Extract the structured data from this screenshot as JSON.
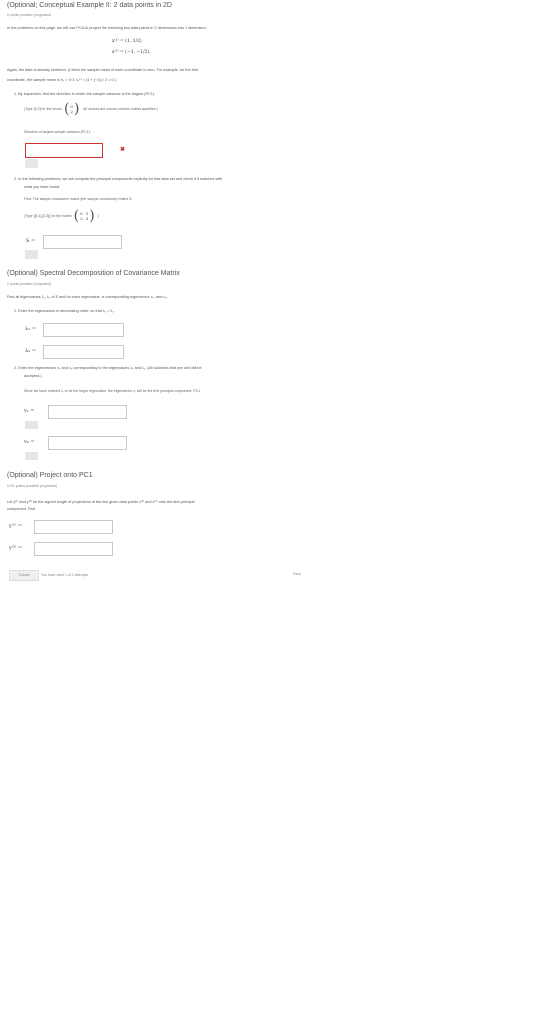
{
  "section1": {
    "title": "(Optional; Conceptual Example II: 2 data points in 2D",
    "meta": "0 points possible (ungraded)",
    "intro": "In the problems on this page, we will use PCA to project the following two data points in 2 dimensions into 1 dimension:",
    "x1": "x⁽¹⁾ = (1, 1/2)",
    "x2": "x⁽²⁾ = (−1, −1/2).",
    "again_line1": "Again, the data is already centered. (Check the sample mean of each coordinate is zero. For example, for the first",
    "again_line2": "coordinate, the sample mean is x̄₁ = ½ Σ x₁⁽ⁱ⁾ = (1 + (−1)) / 2 = 0.)",
    "q1": "1. By inspection, find the direction in which the sample variance is the largest (PC1).",
    "q1_type_prefix": "(Type [0,2] for the vector",
    "q1_type_vec_top": "0",
    "q1_type_vec_bot": "2",
    "q1_type_suffix": ". All vectors are column vectors unless specified.)",
    "q1_dir_label": "Direction of largest sample variance (PC1):",
    "q2_line1": "2. In the following problems, we will compute the principal components explicitly for this data set and check if it matches with",
    "q2_line2": "what you have found.",
    "q2_find": "First: The sample covariance matrix (the sample covariance) matrix S.",
    "q2_type_prefix": "(Type [[0,1],[2,3]] for the matrix",
    "m_a": "0",
    "m_b": "1",
    "m_c": "2",
    "m_d": "3",
    "q2_type_suffix": ".)",
    "S_label": "S ="
  },
  "section2": {
    "title": "(Optional) Spectral Decomposition of Covariance Matrix",
    "meta": "0 points possible (ungraded)",
    "find": "Find all eigenvalues λ₁, λ₂ of S and for each eigenvalue, a corresponding eigenvector v₁, and v₂.",
    "p1": "1. Enter the eigenvalues in decreasing order, so that λ₁ > λ₂.",
    "l1": "λ₁ =",
    "l2": "λ₂ =",
    "p2_line1": "2. Enter the eigenvectors v₁ and v₂ corresponding to the eigenvalues λ₁ and λ₂. (All solutions that are unit will be",
    "p2_line2": "accepted.)",
    "since": "Since we have ordered λ₁ to be the larger eigenvalue, the eigenvector v₁ will be the first principal component, PC1.",
    "v1": "v₁ =",
    "v2": "v₂ ="
  },
  "section3": {
    "title": "(Optional) Project onto PC1",
    "meta": "0.0/1 points possible (ungraded)",
    "let_line1": "Let y⁽¹⁾ and y⁽²⁾ be the signed length of projections of the two given data points x⁽¹⁾ and x⁽²⁾ onto the first principle",
    "let_line2": "component. Find",
    "y1": "y⁽¹⁾ =",
    "y2": "y⁽²⁾ ="
  },
  "footer": {
    "submit": "Submit",
    "attempts": "You have used 1 of 2 attempts",
    "save": "Save"
  },
  "colors": {
    "error": "#cc3333",
    "text": "#555555"
  }
}
